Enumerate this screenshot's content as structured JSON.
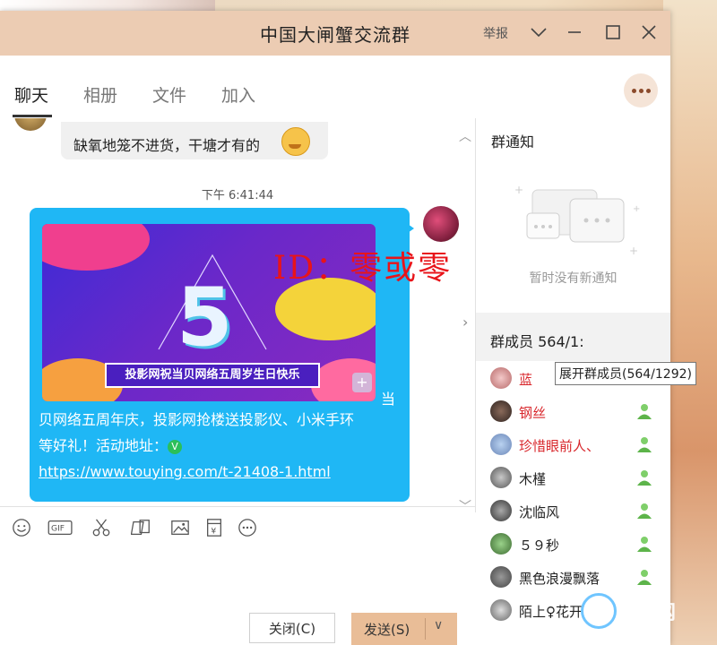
{
  "window": {
    "title": "中国大闸蟹交流群",
    "report_label": "举报"
  },
  "tabs": [
    {
      "label": "聊天",
      "active": true
    },
    {
      "label": "相册"
    },
    {
      "label": "文件"
    },
    {
      "label": "加入"
    }
  ],
  "chat": {
    "prev_message": "缺氧地笼不进货，干塘才有的",
    "timestamp": "下午 6:41:44",
    "banner_caption": "投影网祝当贝网络五周岁生日快乐",
    "banner_number": "5",
    "message_line1": "贝网络五周年庆，投影网抢楼送投影仪、小米手环",
    "message_line2": "等好礼！活动地址：",
    "message_link": "https://www.touying.com/t-21408-1.html",
    "message_prefix_tail": "当",
    "overlay_watermark": "ID：零或零"
  },
  "toolbar": {
    "tools": [
      "emoji-icon",
      "gif-icon",
      "scissors-icon",
      "shape-icon",
      "image-icon",
      "red-packet-icon",
      "more-icon"
    ]
  },
  "buttons": {
    "close_label": "关闭(C)",
    "send_label": "发送(S)"
  },
  "right_panel": {
    "notice_title": "群通知",
    "notice_empty": "暂时没有新通知",
    "members_title": "群成员 564/1:",
    "members_tooltip": "展开群成员(564/1292)",
    "members": [
      {
        "name": "蓝",
        "red": true
      },
      {
        "name": "钢丝",
        "red": true
      },
      {
        "name": "珍惜眼前人、",
        "red": true
      },
      {
        "name": "木槿",
        "red": false
      },
      {
        "name": "沈临风",
        "red": false
      },
      {
        "name": "５９秒",
        "red": false
      },
      {
        "name": "黑色浪漫飘落",
        "red": false
      },
      {
        "name": "陌上♀花开",
        "red": false
      }
    ]
  },
  "corner_logo": "投影网",
  "colors": {
    "titlebar": "#ecccb3",
    "bubble": "#1fb7f5",
    "send_button": "#e9bd97",
    "watermark": "#e8141a"
  }
}
